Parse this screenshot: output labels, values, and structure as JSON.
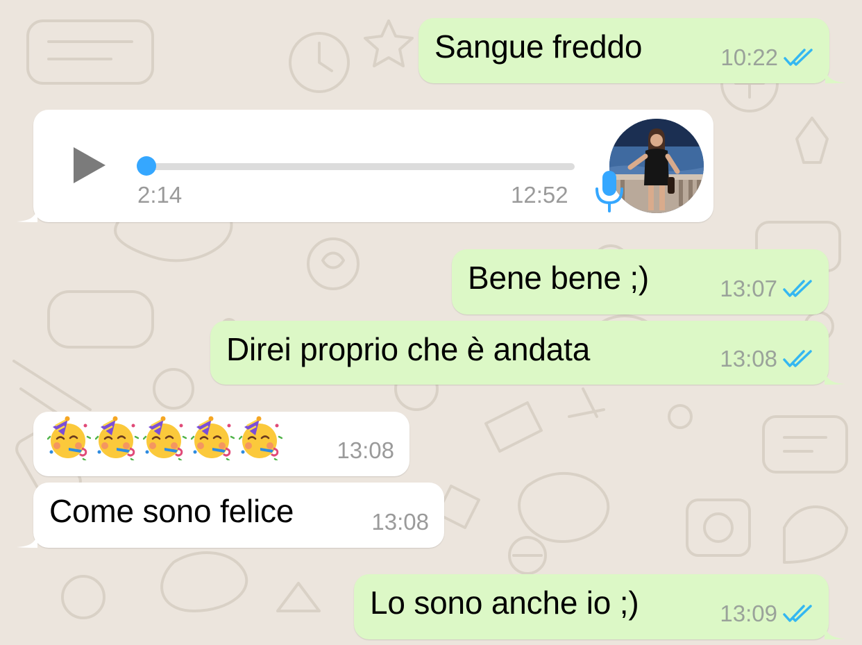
{
  "chat": {
    "messages": [
      {
        "direction": "outgoing",
        "text": "Sangue freddo",
        "time": "10:22",
        "status": "read"
      },
      {
        "direction": "incoming",
        "type": "voice",
        "current_position": "2:14",
        "time": "12:52",
        "progress": 0.0
      },
      {
        "direction": "outgoing",
        "text": "Bene bene ;)",
        "time": "13:07",
        "status": "read"
      },
      {
        "direction": "outgoing",
        "text": "Direi proprio che è andata",
        "time": "13:08",
        "status": "read"
      },
      {
        "direction": "incoming",
        "type": "emoji",
        "emoji_name": "partying-face",
        "emoji_count": 5,
        "time": "13:08"
      },
      {
        "direction": "incoming",
        "text": "Come sono felice",
        "time": "13:08"
      },
      {
        "direction": "outgoing",
        "text": "Lo sono anche io ;)",
        "time": "13:09",
        "status": "read"
      }
    ]
  },
  "icons": {
    "read_ticks": "double-check-icon",
    "play": "play-icon",
    "mic": "microphone-icon",
    "avatar": "contact-avatar"
  },
  "colors": {
    "wallpaper": "#ece5dd",
    "outgoing_bubble": "#dcf8c6",
    "incoming_bubble": "#ffffff",
    "read_ticks": "#34b7f1",
    "audio_accent": "#35a7ff",
    "timestamp": "#9a9a9a"
  }
}
